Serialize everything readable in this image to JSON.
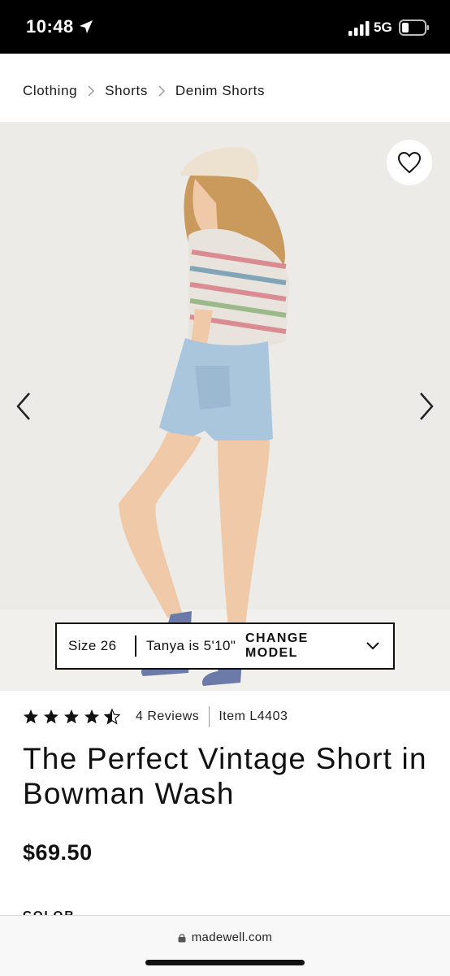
{
  "status_bar": {
    "time": "10:48",
    "network": "5G",
    "icons": [
      "location-arrow-icon",
      "signal-bars-icon",
      "battery-icon"
    ]
  },
  "breadcrumb": {
    "items": [
      "Clothing",
      "Shorts",
      "Denim Shorts"
    ],
    "separator_icon": "chevron-right-icon"
  },
  "gallery": {
    "icons": [
      "heart-icon",
      "chevron-left-icon",
      "chevron-right-icon"
    ]
  },
  "model_bar": {
    "size": "Size 26",
    "model": "Tanya is 5'10\"",
    "change_label": "CHANGE MODEL",
    "chevron_icon": "chevron-down-icon"
  },
  "product": {
    "rating": 4.5,
    "rating_max": 5,
    "reviews": "4 Reviews",
    "item": "Item L4403",
    "title": "The Perfect Vintage Short in Bowman Wash",
    "price": "$69.50",
    "color_label": "COLOR"
  },
  "browser": {
    "url": "madewell.com",
    "lock_icon": "lock-icon"
  },
  "colors": {
    "status_bar_bg": "#000000",
    "hero_bg": "#ededea",
    "text": "#111111"
  }
}
